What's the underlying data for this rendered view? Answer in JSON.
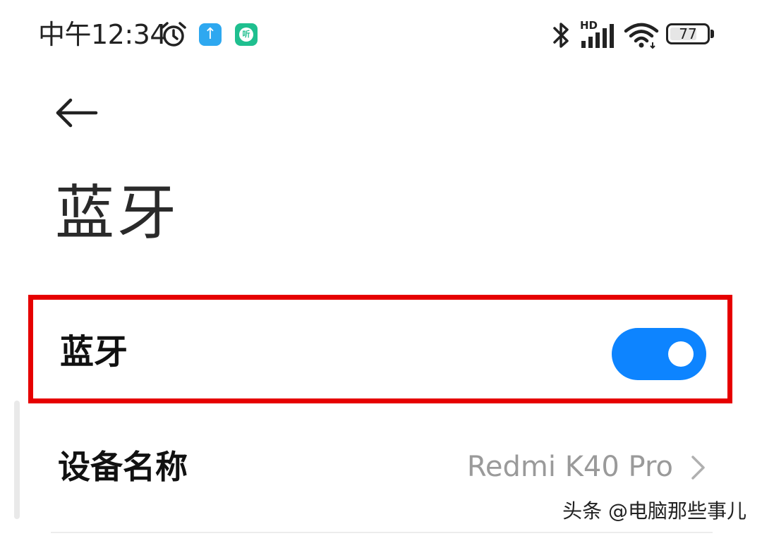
{
  "status_bar": {
    "time": "中午12:34",
    "network_badge": "HD",
    "battery_level": "77",
    "battery_fraction": 0.77,
    "icons": [
      "alarm-icon",
      "upload-app-icon",
      "listen-app-icon",
      "bluetooth-icon",
      "signal-icon",
      "wifi-icon",
      "battery-icon"
    ],
    "listen_app_glyph": "听"
  },
  "header": {
    "title": "蓝牙"
  },
  "bluetooth_row": {
    "label": "蓝牙",
    "enabled": true,
    "highlight_color": "#e60000",
    "toggle_color": "#0d84ff"
  },
  "device_name_row": {
    "label": "设备名称",
    "value": "Redmi K40 Pro"
  },
  "watermark": "头条 @电脑那些事儿"
}
